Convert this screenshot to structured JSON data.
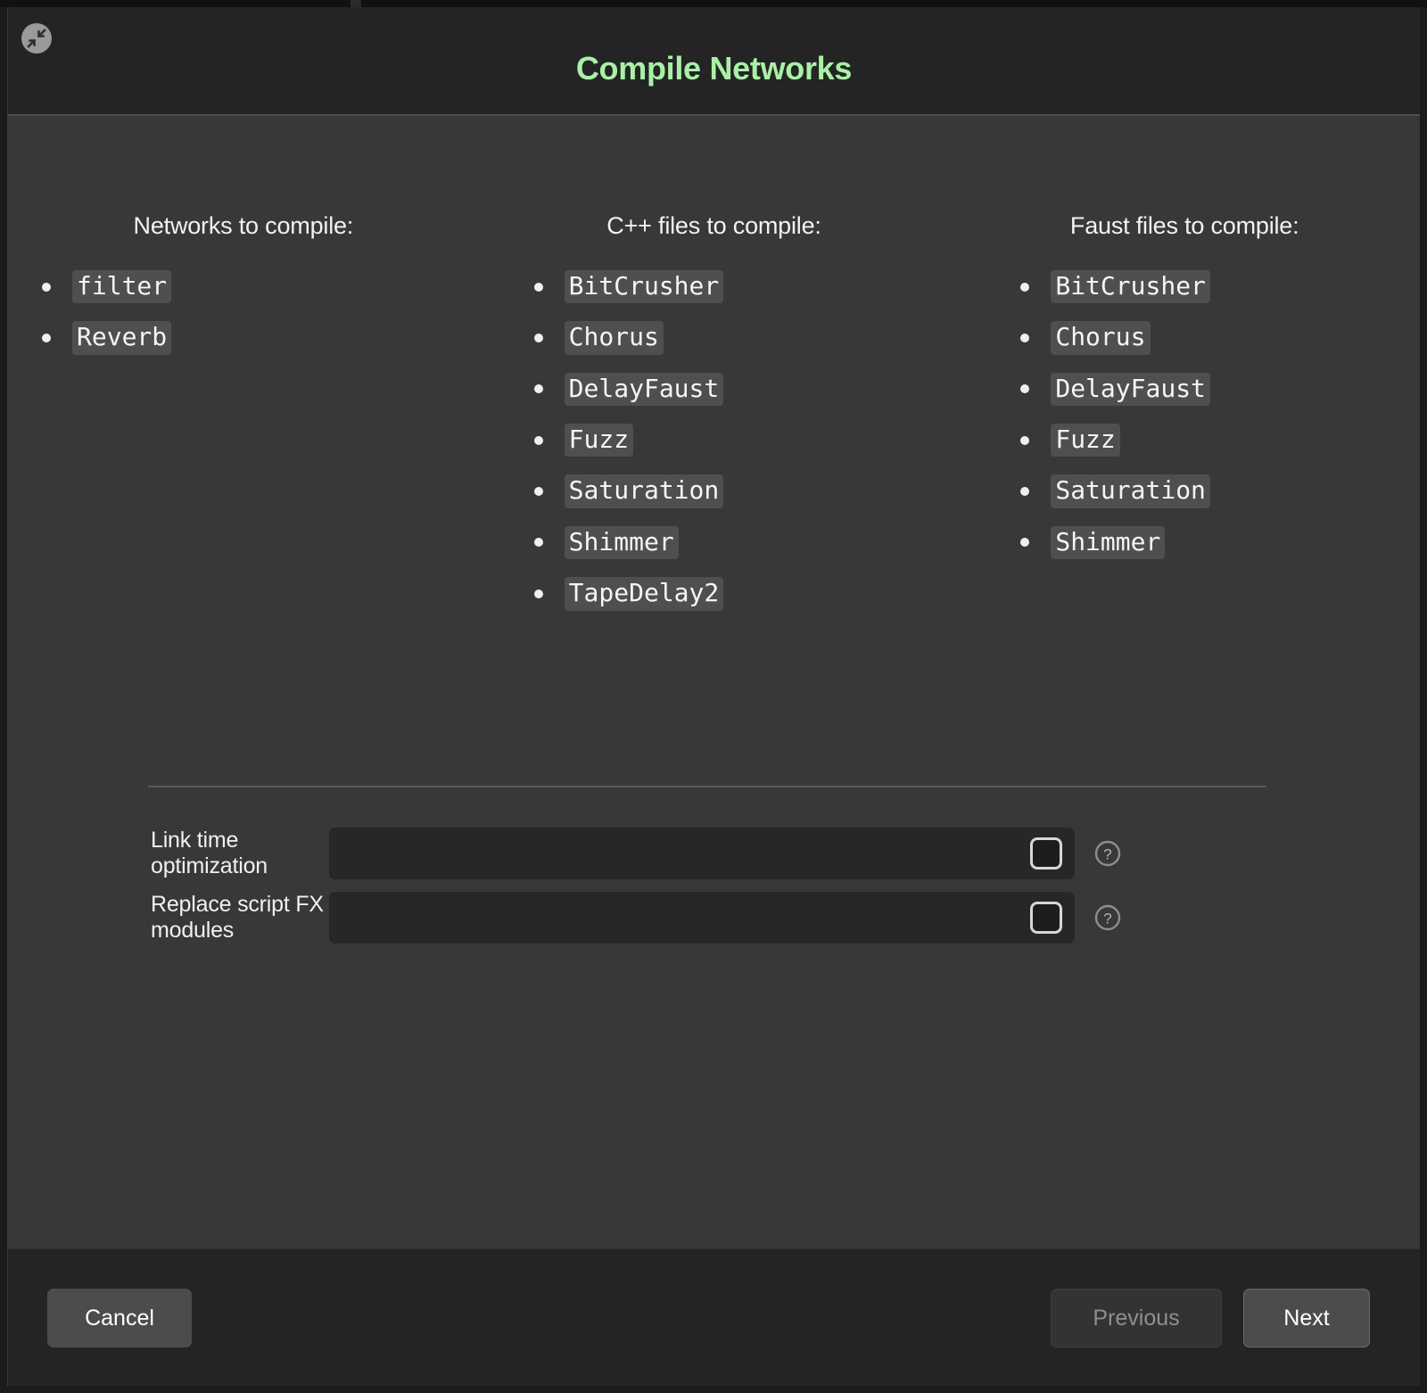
{
  "window": {
    "title": "Compile Networks",
    "title_color": "#a9f0a7",
    "collapse_icon": "collapse-arrows-icon"
  },
  "columns": [
    {
      "heading": "Networks to compile:",
      "items": [
        "filter",
        "Reverb"
      ]
    },
    {
      "heading": "C++ files to compile:",
      "items": [
        "BitCrusher",
        "Chorus",
        "DelayFaust",
        "Fuzz",
        "Saturation",
        "Shimmer",
        "TapeDelay2"
      ]
    },
    {
      "heading": "Faust files to compile:",
      "items": [
        "BitCrusher",
        "Chorus",
        "DelayFaust",
        "Fuzz",
        "Saturation",
        "Shimmer"
      ]
    }
  ],
  "options": [
    {
      "label": "Link time optimization",
      "checked": false,
      "help_icon": "question-mark-icon"
    },
    {
      "label": "Replace script FX modules",
      "checked": false,
      "help_icon": "question-mark-icon"
    }
  ],
  "footer": {
    "cancel_label": "Cancel",
    "previous_label": "Previous",
    "next_label": "Next",
    "previous_disabled": true
  }
}
